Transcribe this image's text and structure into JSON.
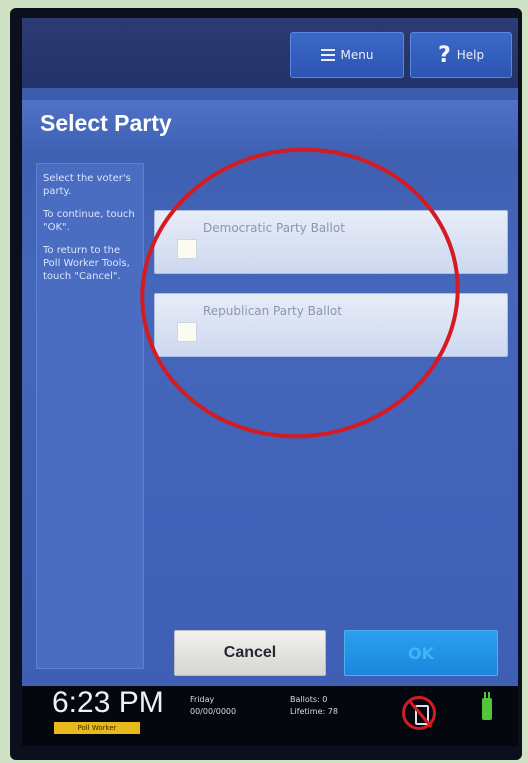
{
  "header": {
    "menu_label": "Menu",
    "help_label": "Help"
  },
  "page": {
    "title": "Select Party"
  },
  "instructions": [
    "Select the voter's party.",
    "To continue, touch \"OK\".",
    "To return to the Poll Worker Tools, touch \"Cancel\"."
  ],
  "options": [
    {
      "label": "Democratic Party Ballot",
      "checked": false
    },
    {
      "label": "Republican Party Ballot",
      "checked": false
    }
  ],
  "actions": {
    "cancel_label": "Cancel",
    "ok_label": "OK"
  },
  "status": {
    "time": "6:23 PM",
    "mode": "Poll Worker",
    "day": "Friday",
    "date": "00/00/0000",
    "ballots_label": "Ballots:",
    "ballots_value": "0",
    "lifetime_label": "Lifetime:",
    "lifetime_value": "78"
  },
  "colors": {
    "highlight_ring": "#d61a22",
    "ok_button": "#1b86dc",
    "mode_badge": "#e9b81b",
    "power": "#53c53c"
  }
}
